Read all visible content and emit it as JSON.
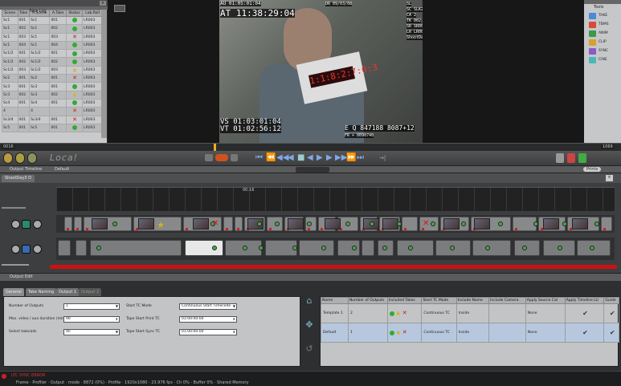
{
  "take_log": {
    "title": "Take Log",
    "columns": [
      "Scene",
      "Take",
      "A.Scene",
      "A.Take",
      "Status",
      "Lab.Roll"
    ],
    "rows": [
      {
        "scene": "Sc1",
        "take": "001",
        "ascene": "Sc1",
        "atake": "001",
        "status": "good",
        "roll": "LR003"
      },
      {
        "scene": "Sc1",
        "take": "002",
        "ascene": "Sc1",
        "atake": "002",
        "status": "good",
        "roll": "LR003"
      },
      {
        "scene": "Sc1",
        "take": "003",
        "ascene": "Sc1",
        "atake": "003",
        "status": "bad",
        "roll": "LR003"
      },
      {
        "scene": "Sc1",
        "take": "004",
        "ascene": "Sc1",
        "atake": "004",
        "status": "good",
        "roll": "LR003"
      },
      {
        "scene": "Sc1/2",
        "take": "001",
        "ascene": "Sc1/2",
        "atake": "001",
        "status": "good",
        "roll": "LR003"
      },
      {
        "scene": "Sc1/2",
        "take": "002",
        "ascene": "Sc1/2",
        "atake": "002",
        "status": "good",
        "roll": "LR003"
      },
      {
        "scene": "Sc1/2",
        "take": "003",
        "ascene": "Sc1/2",
        "atake": "003",
        "status": "circled",
        "roll": "LR003"
      },
      {
        "scene": "Sc2",
        "take": "001",
        "ascene": "Sc2",
        "atake": "001",
        "status": "bad",
        "roll": "LR003"
      },
      {
        "scene": "Sc3",
        "take": "001",
        "ascene": "Sc3",
        "atake": "001",
        "status": "good",
        "roll": "LR003"
      },
      {
        "scene": "Sc3",
        "take": "002",
        "ascene": "Sc3",
        "atake": "002",
        "status": "circled",
        "roll": "LR003"
      },
      {
        "scene": "Sc4",
        "take": "001",
        "ascene": "Sc4",
        "atake": "001",
        "status": "good",
        "roll": "LR003"
      },
      {
        "scene": "4",
        "take": "",
        "ascene": "4",
        "atake": "",
        "status": "bad",
        "roll": "LR003"
      },
      {
        "scene": "Sc3/4",
        "take": "001",
        "ascene": "Sc3/4",
        "atake": "001",
        "status": "bad",
        "roll": "LR003"
      },
      {
        "scene": "Sc5",
        "take": "001",
        "ascene": "Sc5",
        "atake": "001",
        "status": "good",
        "roll": "LR003"
      }
    ]
  },
  "video": {
    "tl_tc": "AU 01:05:01:04",
    "at_tc": "AT 11:38:29:04",
    "date": "DR 09/03/08",
    "meta": [
      "SL",
      "SC SLK2",
      "CA 2",
      "TK 002",
      "SR SR001",
      "LR LR003",
      "ShootDay3 D"
    ],
    "vs_tc": "VS 01:03:01:04",
    "vt_tc": "VT 01:02:56:12",
    "footage": "E Q 847188 8087+12",
    "fr": "FR + 0090740",
    "slate_display": "1:1:8:2:7:0:3"
  },
  "tools": {
    "title": "Tools",
    "items": [
      {
        "label": "TAKE",
        "color": "#4a8ad8"
      },
      {
        "label": "TBMS",
        "color": "#d84a3a"
      },
      {
        "label": "ANIM",
        "color": "#3a9a4a"
      },
      {
        "label": "CLIP",
        "color": "#d8a030"
      },
      {
        "label": "SYNC",
        "color": "#8a5ac8"
      },
      {
        "label": "CINE",
        "color": "#4ab8b8"
      }
    ]
  },
  "ruler": {
    "left": "0016",
    "right": "1069"
  },
  "transport": {
    "logo": "Loca!"
  },
  "output_timeline": {
    "title": "Output Timeline",
    "preset": "Default",
    "tab": "ShootDay3 D",
    "tc": "00:16",
    "button": "Prints"
  },
  "output_edit": {
    "title": "Output Edit",
    "tabs": [
      "General",
      "Take Naming",
      "Output 1",
      "Output 2"
    ],
    "fields": [
      {
        "label": "Number of Outputs",
        "value": "1"
      },
      {
        "label": "Max. video / aux duration (minutes)",
        "value": "90"
      },
      {
        "label": "Select take/ads",
        "value": "All"
      }
    ],
    "fields2": [
      {
        "label": "Start TC Mode",
        "value": "Continuous Start Timecode"
      },
      {
        "label": "Tape Start Print TC",
        "value": "01:00:00:00"
      },
      {
        "label": "Tape Start Sync TC",
        "value": "01:00:00:00"
      }
    ],
    "table": {
      "columns": [
        "Name",
        "Number of Outputs",
        "Included Takes",
        "Start TC Mode",
        "Include Name",
        "Include Camera",
        "Apply Source Cal",
        "Apply Timeline LU",
        "Guide"
      ],
      "rows": [
        {
          "name": "Template 1",
          "outputs": "2",
          "tc_mode": "Continuous TC",
          "include": "Inside",
          "apply": "None"
        },
        {
          "name": "Default",
          "outputs": "1",
          "tc_mode": "Continuous TC",
          "include": "Inside",
          "apply": "None"
        }
      ]
    }
  },
  "status": {
    "warning": "LTC SYNC ERROR",
    "info": "Frame · Profiler · Output · mode · 8872 (0%) · Profile · 1920x1080 · 23.976 fps · Ch 0% · Buffer 0% · Shared Memory"
  }
}
